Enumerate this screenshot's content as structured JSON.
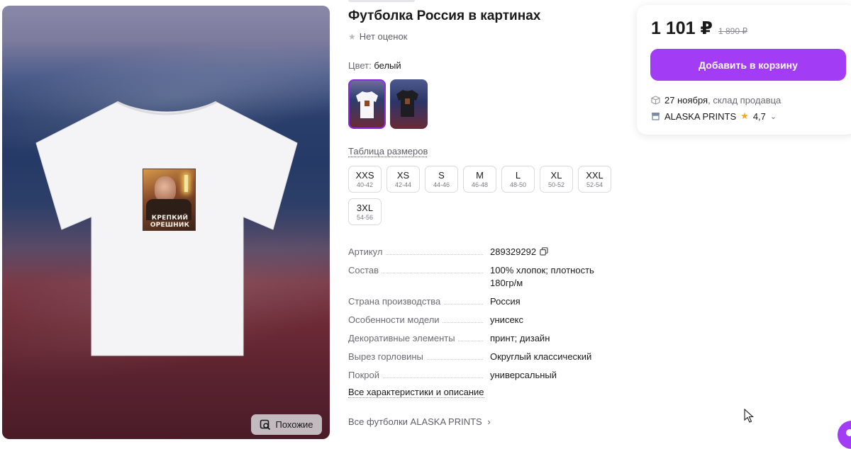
{
  "product": {
    "title": "Футболка Россия в картинах",
    "rating_text": "Нет оценок",
    "print_caption_line1": "КРЕПКИЙ",
    "print_caption_line2": "ОРЕШНИК"
  },
  "gallery": {
    "similar_label": "Похожие"
  },
  "color": {
    "label": "Цвет:",
    "selected": "белый",
    "swatches": [
      "white-tee",
      "black-tee"
    ]
  },
  "sizes": {
    "table_link": "Таблица размеров",
    "items": [
      {
        "label": "XXS",
        "range": "40-42"
      },
      {
        "label": "XS",
        "range": "42-44"
      },
      {
        "label": "S",
        "range": "44-46"
      },
      {
        "label": "M",
        "range": "46-48"
      },
      {
        "label": "L",
        "range": "48-50"
      },
      {
        "label": "XL",
        "range": "50-52"
      },
      {
        "label": "XXL",
        "range": "52-54"
      },
      {
        "label": "3XL",
        "range": "54-56"
      }
    ]
  },
  "specs": [
    {
      "key": "Артикул",
      "value": "289329292"
    },
    {
      "key": "Состав",
      "value": "100% хлопок; плотность 180гр/м"
    },
    {
      "key": "Страна производства",
      "value": "Россия"
    },
    {
      "key": "Особенности модели",
      "value": "унисекс"
    },
    {
      "key": "Декоративные элементы",
      "value": "принт; дизайн"
    },
    {
      "key": "Вырез горловины",
      "value": "Округлый классический"
    },
    {
      "key": "Покрой",
      "value": "универсальный"
    }
  ],
  "links": {
    "all_specs": "Все характеристики и описание",
    "all_tees": "Все футболки ALASKA PRINTS"
  },
  "buy": {
    "price": "1 101 ₽",
    "old_price": "1 890 ₽",
    "cart_button": "Добавить в корзину",
    "delivery_date": "27 ноября",
    "delivery_source": ", склад продавца",
    "seller_name": "ALASKA PRINTS",
    "seller_rating": "4,7"
  },
  "colors": {
    "accent": "#a23cf5",
    "selected_border": "#8a2be2",
    "rating_star": "#f5a623"
  }
}
